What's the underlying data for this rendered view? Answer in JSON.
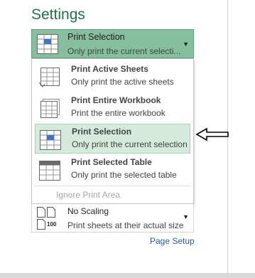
{
  "settings": {
    "title": "Settings",
    "selected": {
      "title": "Print Selection",
      "subtitle": "Only print the current selecti..."
    },
    "menu_items": [
      {
        "title": "Print Active Sheets",
        "subtitle": "Only print the active sheets",
        "icon": "active-sheets-icon",
        "highlighted": false
      },
      {
        "title": "Print Entire Workbook",
        "subtitle": "Print the entire workbook",
        "icon": "entire-workbook-icon",
        "highlighted": false
      },
      {
        "title": "Print Selection",
        "subtitle": "Only print the current selection",
        "icon": "selection-icon",
        "highlighted": true
      },
      {
        "title": "Print Selected Table",
        "subtitle": "Only print the selected table",
        "icon": "selected-table-icon",
        "highlighted": false
      }
    ],
    "ignore_print_area": "Ignore Print Area",
    "scaling": {
      "title": "No Scaling",
      "subtitle": "Print sheets at their actual size",
      "icon_label": "100"
    },
    "page_setup": "Page Setup"
  },
  "colors": {
    "accent": "#217346",
    "selected_bg": "#86bf9d",
    "highlight_bg": "#d3eadc",
    "link": "#2a5f9e"
  }
}
